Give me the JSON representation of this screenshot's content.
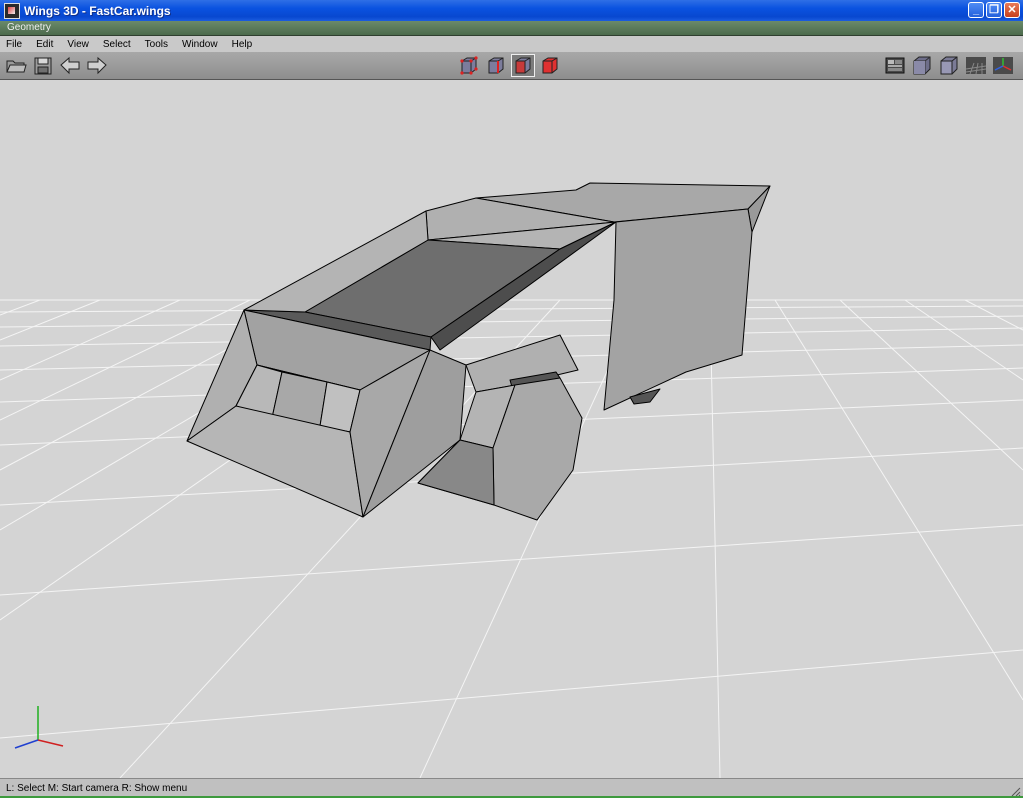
{
  "window": {
    "title": "Wings 3D - FastCar.wings",
    "subwindow_label": "Geometry",
    "buttons": {
      "minimize": "_",
      "maximize": "❐",
      "close": "✕"
    }
  },
  "menu": [
    "File",
    "Edit",
    "View",
    "Select",
    "Tools",
    "Window",
    "Help"
  ],
  "toolbar": {
    "left_icons": [
      "open-folder-icon",
      "save-icon",
      "undo-arrow-icon",
      "redo-arrow-icon"
    ],
    "selection_modes": [
      "vertex-mode-icon",
      "edge-mode-icon",
      "face-mode-icon",
      "body-mode-icon"
    ],
    "selected_mode": "face-mode-icon",
    "right_icons": [
      "workmode-icon",
      "smooth-shading-icon",
      "flat-shading-icon",
      "ground-plane-icon",
      "axes-icon"
    ]
  },
  "status": {
    "text": "L: Select   M: Start camera   R: Show menu"
  },
  "colors": {
    "title_bar": "#0a52e0",
    "geometry_strip": "#5a7a5a",
    "viewport_bg": "#d4d4d4",
    "grid_line": "#ffffff",
    "model_face": "#a0a0a0",
    "model_edge": "#000000",
    "selected_mode": "#cc2222",
    "axis_x": "#d02020",
    "axis_y": "#20b020",
    "axis_z": "#2040d0"
  }
}
